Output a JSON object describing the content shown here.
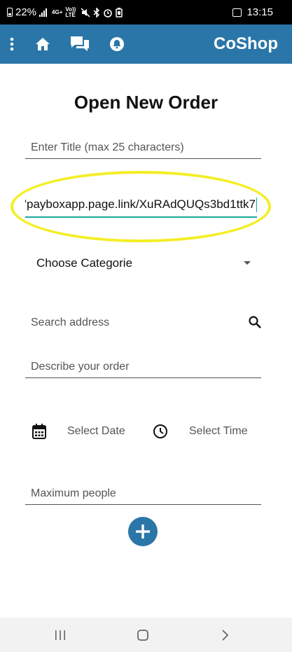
{
  "status_bar": {
    "battery_percent": "22%",
    "network": "4G+",
    "volte": "Vo)) LTE",
    "time": "13:15"
  },
  "app_bar": {
    "title": "CoShop",
    "color": "#2b76a8"
  },
  "form": {
    "heading": "Open New Order",
    "title_placeholder": "Enter Title (max 25 characters)",
    "link_value": "'payboxapp.page.link/XuRAdQUQs3bd1ttk7",
    "category_label": "Choose Categorie",
    "address_placeholder": "Search address",
    "description_placeholder": "Describe your order",
    "date_label": "Select Date",
    "time_label": "Select Time",
    "max_people_placeholder": "Maximum people"
  },
  "colors": {
    "highlight": "#f4ee25",
    "focus_underline": "#1aa89a",
    "fab": "#2b76a8"
  }
}
